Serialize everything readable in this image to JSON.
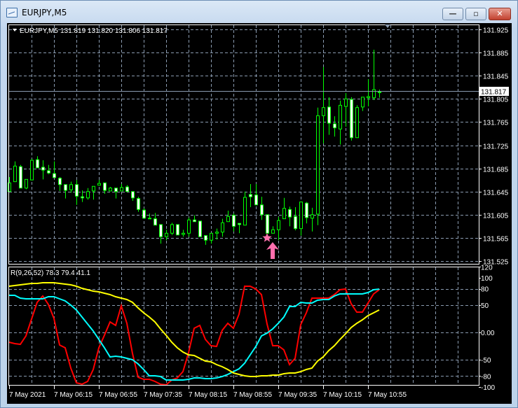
{
  "window": {
    "title": "EURJPY,M5",
    "buttons": {
      "minimize": "—",
      "maximize": "▫",
      "close": "✕"
    }
  },
  "legend": {
    "symbol": "EURJPY,M5",
    "ohlc": "131.819 131.820 131.806 131.817"
  },
  "price_axis": {
    "labels": [
      "131.925",
      "131.885",
      "131.845",
      "131.805",
      "131.765",
      "131.725",
      "131.685",
      "131.645",
      "131.605",
      "131.565",
      "131.525"
    ],
    "current_price": "131.817"
  },
  "indicator": {
    "label": "R(9,26,52) 78.3 79.4 41.1",
    "axis_labels": [
      "120",
      "100",
      "80",
      "50",
      "0.00",
      "-50",
      "-80",
      "-100"
    ]
  },
  "time_axis": {
    "labels": [
      "7 May 2021",
      "7 May 06:15",
      "7 May 06:55",
      "7 May 07:35",
      "7 May 08:15",
      "7 May 08:55",
      "7 May 09:35",
      "7 May 10:15",
      "7 May 10:55"
    ]
  },
  "colors": {
    "bull_body": "#000000",
    "bear_body": "#ffffff",
    "candle_line": "#00ff00",
    "grid": "#8a9bb0",
    "fast": "#ff0000",
    "mid": "#00ffff",
    "slow": "#ffff00",
    "signal": "#ff6fae"
  },
  "chart_data": [
    {
      "type": "candlestick",
      "title": "EURJPY,M5",
      "ylim": [
        131.525,
        131.925
      ],
      "candles_ohlc": [
        [
          131.645,
          131.67,
          131.645,
          131.66
        ],
        [
          131.662,
          131.697,
          131.662,
          131.689
        ],
        [
          131.688,
          131.691,
          131.651,
          131.651
        ],
        [
          131.651,
          131.666,
          131.649,
          131.666
        ],
        [
          131.665,
          131.701,
          131.665,
          131.699
        ],
        [
          131.7,
          131.706,
          131.686,
          131.686
        ],
        [
          131.687,
          131.699,
          131.666,
          131.682
        ],
        [
          131.681,
          131.691,
          131.675,
          131.677
        ],
        [
          131.676,
          131.697,
          131.669,
          131.669
        ],
        [
          131.668,
          131.67,
          131.646,
          131.657
        ],
        [
          131.657,
          131.657,
          131.633,
          131.647
        ],
        [
          131.648,
          131.662,
          131.643,
          131.657
        ],
        [
          131.657,
          131.665,
          131.622,
          131.637
        ],
        [
          131.636,
          131.647,
          131.627,
          131.634
        ],
        [
          131.634,
          131.651,
          131.631,
          131.645
        ],
        [
          131.646,
          131.654,
          131.631,
          131.654
        ],
        [
          131.656,
          131.665,
          131.656,
          131.659
        ],
        [
          131.66,
          131.66,
          131.641,
          131.647
        ],
        [
          131.646,
          131.653,
          131.646,
          131.651
        ],
        [
          131.651,
          131.651,
          131.633,
          131.645
        ],
        [
          131.646,
          131.658,
          131.646,
          131.652
        ],
        [
          131.653,
          131.656,
          131.645,
          131.645
        ],
        [
          131.645,
          131.645,
          131.629,
          131.634
        ],
        [
          131.633,
          131.636,
          131.61,
          131.614
        ],
        [
          131.613,
          131.616,
          131.598,
          131.599
        ],
        [
          131.599,
          131.607,
          131.599,
          131.599
        ],
        [
          131.598,
          131.608,
          131.587,
          131.587
        ],
        [
          131.588,
          131.588,
          131.555,
          131.567
        ],
        [
          131.567,
          131.579,
          131.561,
          131.573
        ],
        [
          131.573,
          131.591,
          131.57,
          131.588
        ],
        [
          131.588,
          131.588,
          131.57,
          131.57
        ],
        [
          131.571,
          131.579,
          131.567,
          131.573
        ],
        [
          131.573,
          131.6,
          131.567,
          131.596
        ],
        [
          131.596,
          131.604,
          131.593,
          131.593
        ],
        [
          131.594,
          131.594,
          131.567,
          131.567
        ],
        [
          131.569,
          131.569,
          131.553,
          131.561
        ],
        [
          131.561,
          131.573,
          131.555,
          131.573
        ],
        [
          131.573,
          131.581,
          131.562,
          131.575
        ],
        [
          131.575,
          131.598,
          131.567,
          131.591
        ],
        [
          131.593,
          131.612,
          131.593,
          131.602
        ],
        [
          131.604,
          131.607,
          131.576,
          131.585
        ],
        [
          131.59,
          131.59,
          131.573,
          131.588
        ],
        [
          131.587,
          131.645,
          131.587,
          131.635
        ],
        [
          131.64,
          131.658,
          131.618,
          131.636
        ],
        [
          131.639,
          131.658,
          131.622,
          131.622
        ],
        [
          131.622,
          131.636,
          131.596,
          131.605
        ],
        [
          131.605,
          131.605,
          131.573,
          131.573
        ],
        [
          131.573,
          131.585,
          131.573,
          131.579
        ],
        [
          131.579,
          131.601,
          131.561,
          131.595
        ],
        [
          131.598,
          131.634,
          131.598,
          131.616
        ],
        [
          131.614,
          131.619,
          131.585,
          131.601
        ],
        [
          131.602,
          131.618,
          131.578,
          131.581
        ],
        [
          131.581,
          131.627,
          131.569,
          131.627
        ],
        [
          131.625,
          131.627,
          131.59,
          131.6
        ],
        [
          131.599,
          131.617,
          131.576,
          131.605
        ],
        [
          131.606,
          131.79,
          131.587,
          131.776
        ],
        [
          131.776,
          131.86,
          131.728,
          131.79
        ],
        [
          131.791,
          131.808,
          131.743,
          131.763
        ],
        [
          131.762,
          131.775,
          131.74,
          131.755
        ],
        [
          131.753,
          131.802,
          131.726,
          131.794
        ],
        [
          131.792,
          131.815,
          131.757,
          131.805
        ],
        [
          131.804,
          131.808,
          131.733,
          131.738
        ],
        [
          131.738,
          131.794,
          131.738,
          131.79
        ],
        [
          131.791,
          131.808,
          131.784,
          131.808
        ],
        [
          131.807,
          131.839,
          131.792,
          131.809
        ],
        [
          131.807,
          131.89,
          131.803,
          131.821
        ],
        [
          131.817,
          131.821,
          131.807,
          131.817
        ]
      ],
      "current_price": 131.817,
      "signals": [
        {
          "type": "star",
          "bar": 46,
          "price": 131.565
        },
        {
          "type": "buy-arrow",
          "bar": 47
        }
      ]
    },
    {
      "type": "line",
      "title": "R(9,26,52)",
      "ylim": [
        -100,
        120
      ],
      "series": [
        {
          "name": "fast",
          "values": [
            -17.9,
            -20.5,
            -21.8,
            -6.4,
            24.4,
            55.1,
            66.7,
            51.3,
            25.6,
            -23.1,
            -28.2,
            -65.4,
            -92.3,
            -94.9,
            -89.7,
            -67.9,
            -28.2,
            -5.1,
            19.2,
            12.8,
            48.7,
            16.7,
            -38.5,
            -82.1,
            -85.9,
            -85.9,
            -89.7,
            -94.9,
            -96.2,
            -87.2,
            -83.3,
            -71.8,
            -37.2,
            7.7,
            12.8,
            -12.8,
            -24.4,
            -25.6,
            3.8,
            16.7,
            7.7,
            33.3,
            84.6,
            84.6,
            79.5,
            69.2,
            15.4,
            -24.4,
            -24.4,
            -32.1,
            -59.0,
            -47.4,
            14.1,
            35.9,
            62.8,
            62.8,
            62.8,
            62.8,
            69.2,
            78.2,
            79.5,
            52.6,
            37.2,
            37.2,
            53.8,
            70.5,
            78.3
          ]
        },
        {
          "name": "mid",
          "values": [
            67.9,
            67.9,
            62.8,
            61.5,
            61.5,
            61.5,
            61.5,
            65.4,
            65.4,
            61.5,
            57.7,
            50.0,
            41.0,
            28.2,
            15.4,
            2.6,
            -12.8,
            -28.2,
            -44.9,
            -43.6,
            -44.9,
            -47.4,
            -50.0,
            -57.7,
            -67.9,
            -79.5,
            -79.5,
            -80.8,
            -87.2,
            -87.2,
            -87.2,
            -87.2,
            -85.9,
            -83.3,
            -83.3,
            -84.6,
            -84.6,
            -83.3,
            -80.8,
            -76.9,
            -71.8,
            -66.7,
            -56.4,
            -41.0,
            -25.6,
            -6.4,
            -1.3,
            6.4,
            16.7,
            28.2,
            47.4,
            47.4,
            55.1,
            53.8,
            53.8,
            59.0,
            60.3,
            60.3,
            66.7,
            70.5,
            70.5,
            70.5,
            70.5,
            70.5,
            73.1,
            78.2,
            79.4
          ]
        },
        {
          "name": "slow",
          "values": [
            84.6,
            85.9,
            87.2,
            88.5,
            89.7,
            89.7,
            91.0,
            91.0,
            91.0,
            89.7,
            88.5,
            87.2,
            84.6,
            80.8,
            78.2,
            75.6,
            74.4,
            71.8,
            69.2,
            65.4,
            62.8,
            60.3,
            55.1,
            44.9,
            35.9,
            28.2,
            19.2,
            6.4,
            -5.1,
            -17.9,
            -28.2,
            -35.9,
            -41.0,
            -42.3,
            -47.4,
            -52.6,
            -53.8,
            -59.0,
            -62.8,
            -67.9,
            -74.4,
            -76.9,
            -79.5,
            -80.8,
            -80.8,
            -79.5,
            -79.5,
            -78.2,
            -78.2,
            -75.6,
            -74.4,
            -74.4,
            -71.8,
            -67.9,
            -65.4,
            -52.6,
            -44.9,
            -33.3,
            -24.4,
            -12.8,
            -2.6,
            9.0,
            16.7,
            23.1,
            30.8,
            35.9,
            41.1
          ]
        }
      ],
      "hlines": [
        80,
        50,
        0,
        -50,
        -80
      ]
    }
  ]
}
